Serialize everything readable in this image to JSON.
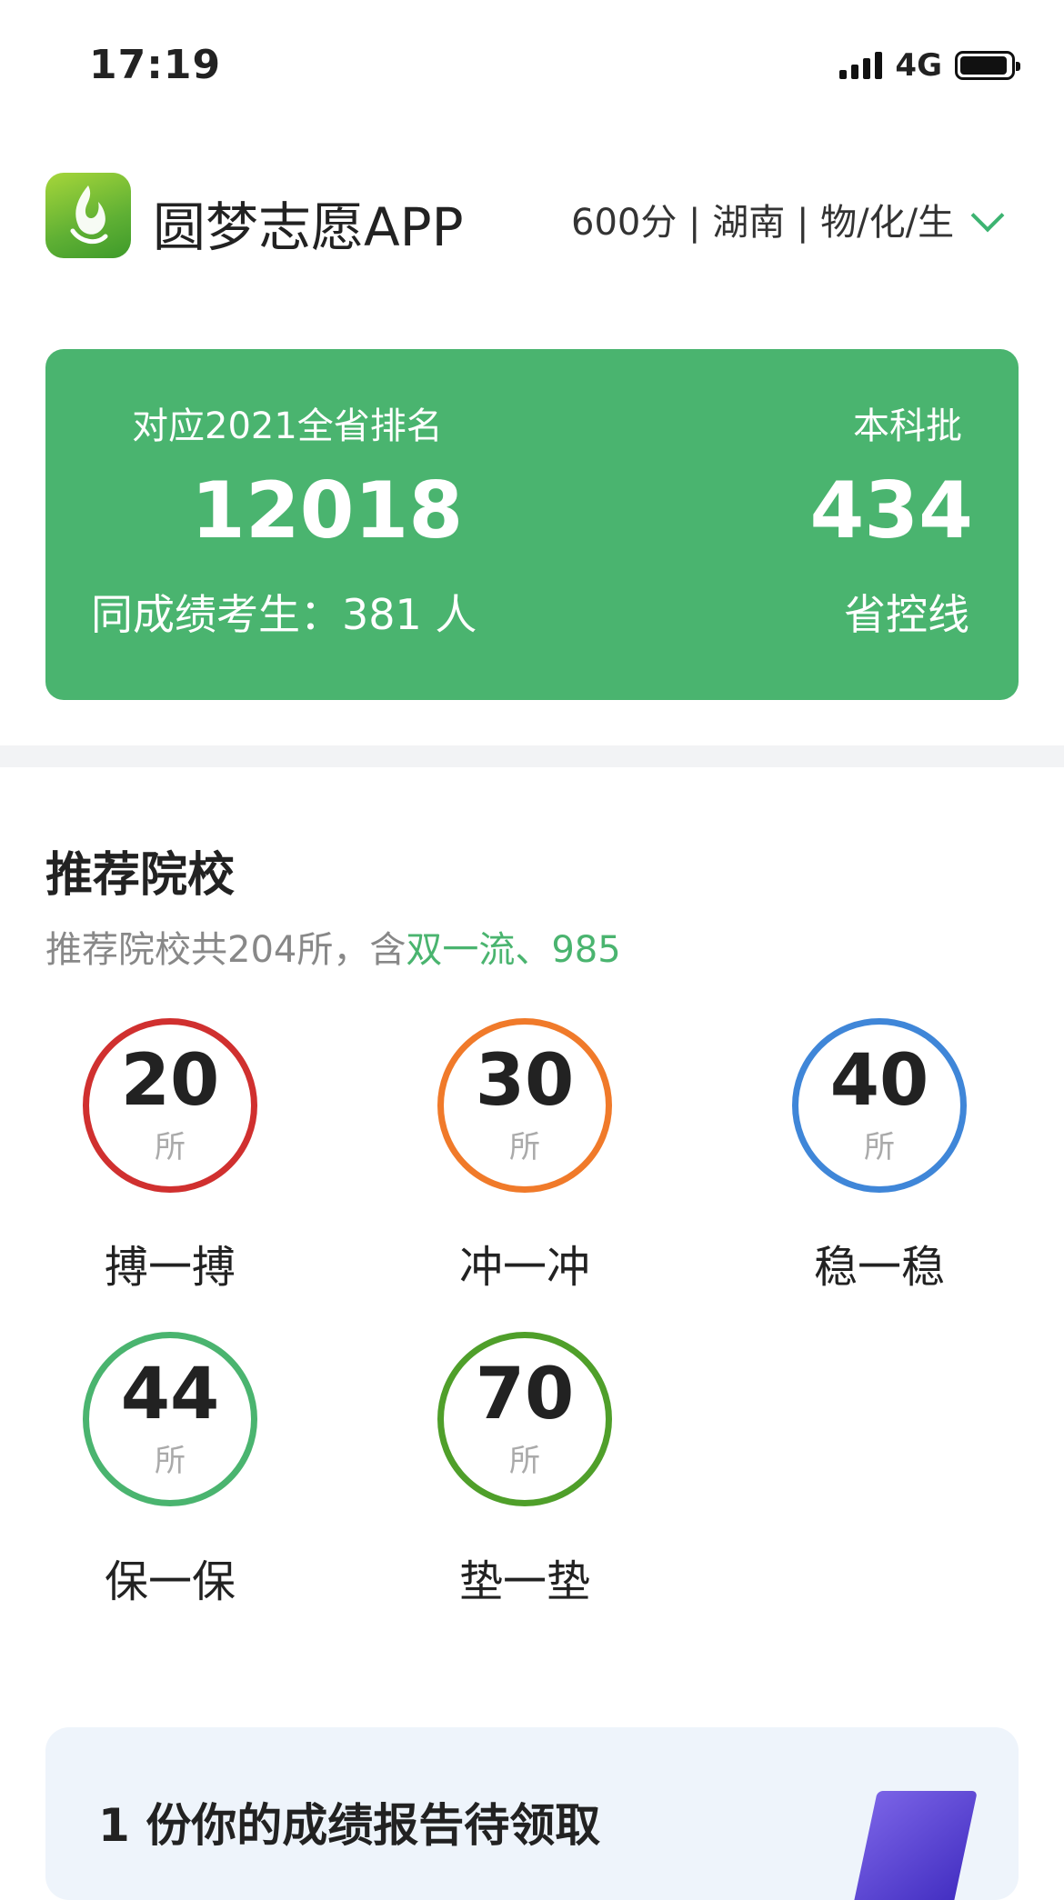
{
  "status": {
    "time": "17:19",
    "network": "4G"
  },
  "header": {
    "app_name": "圆梦志愿APP",
    "selector": "600分 | 湖南 | 物/化/生"
  },
  "card": {
    "rank_label": "对应2021全省排名",
    "rank_value": "12018",
    "same_score": "同成绩考生：381 人",
    "batch_label": "本科批",
    "batch_value": "434",
    "control_line": "省控线"
  },
  "recommend": {
    "title": "推荐院校",
    "subtitle_prefix": "推荐院校共204所，含",
    "subtitle_highlight": "双一流、985",
    "unit": "所",
    "tiers": [
      {
        "count": "20",
        "label": "搏一搏",
        "color": "#d0302f"
      },
      {
        "count": "30",
        "label": "冲一冲",
        "color": "#f07a2a"
      },
      {
        "count": "40",
        "label": "稳一稳",
        "color": "#3f86d8"
      },
      {
        "count": "44",
        "label": "保一保",
        "color": "#4ab46f"
      },
      {
        "count": "70",
        "label": "垫一垫",
        "color": "#4f9f2a"
      }
    ]
  },
  "banner": {
    "text": "1 份你的成绩报告待领取"
  },
  "colors": {
    "accent": "#4ab46f"
  }
}
